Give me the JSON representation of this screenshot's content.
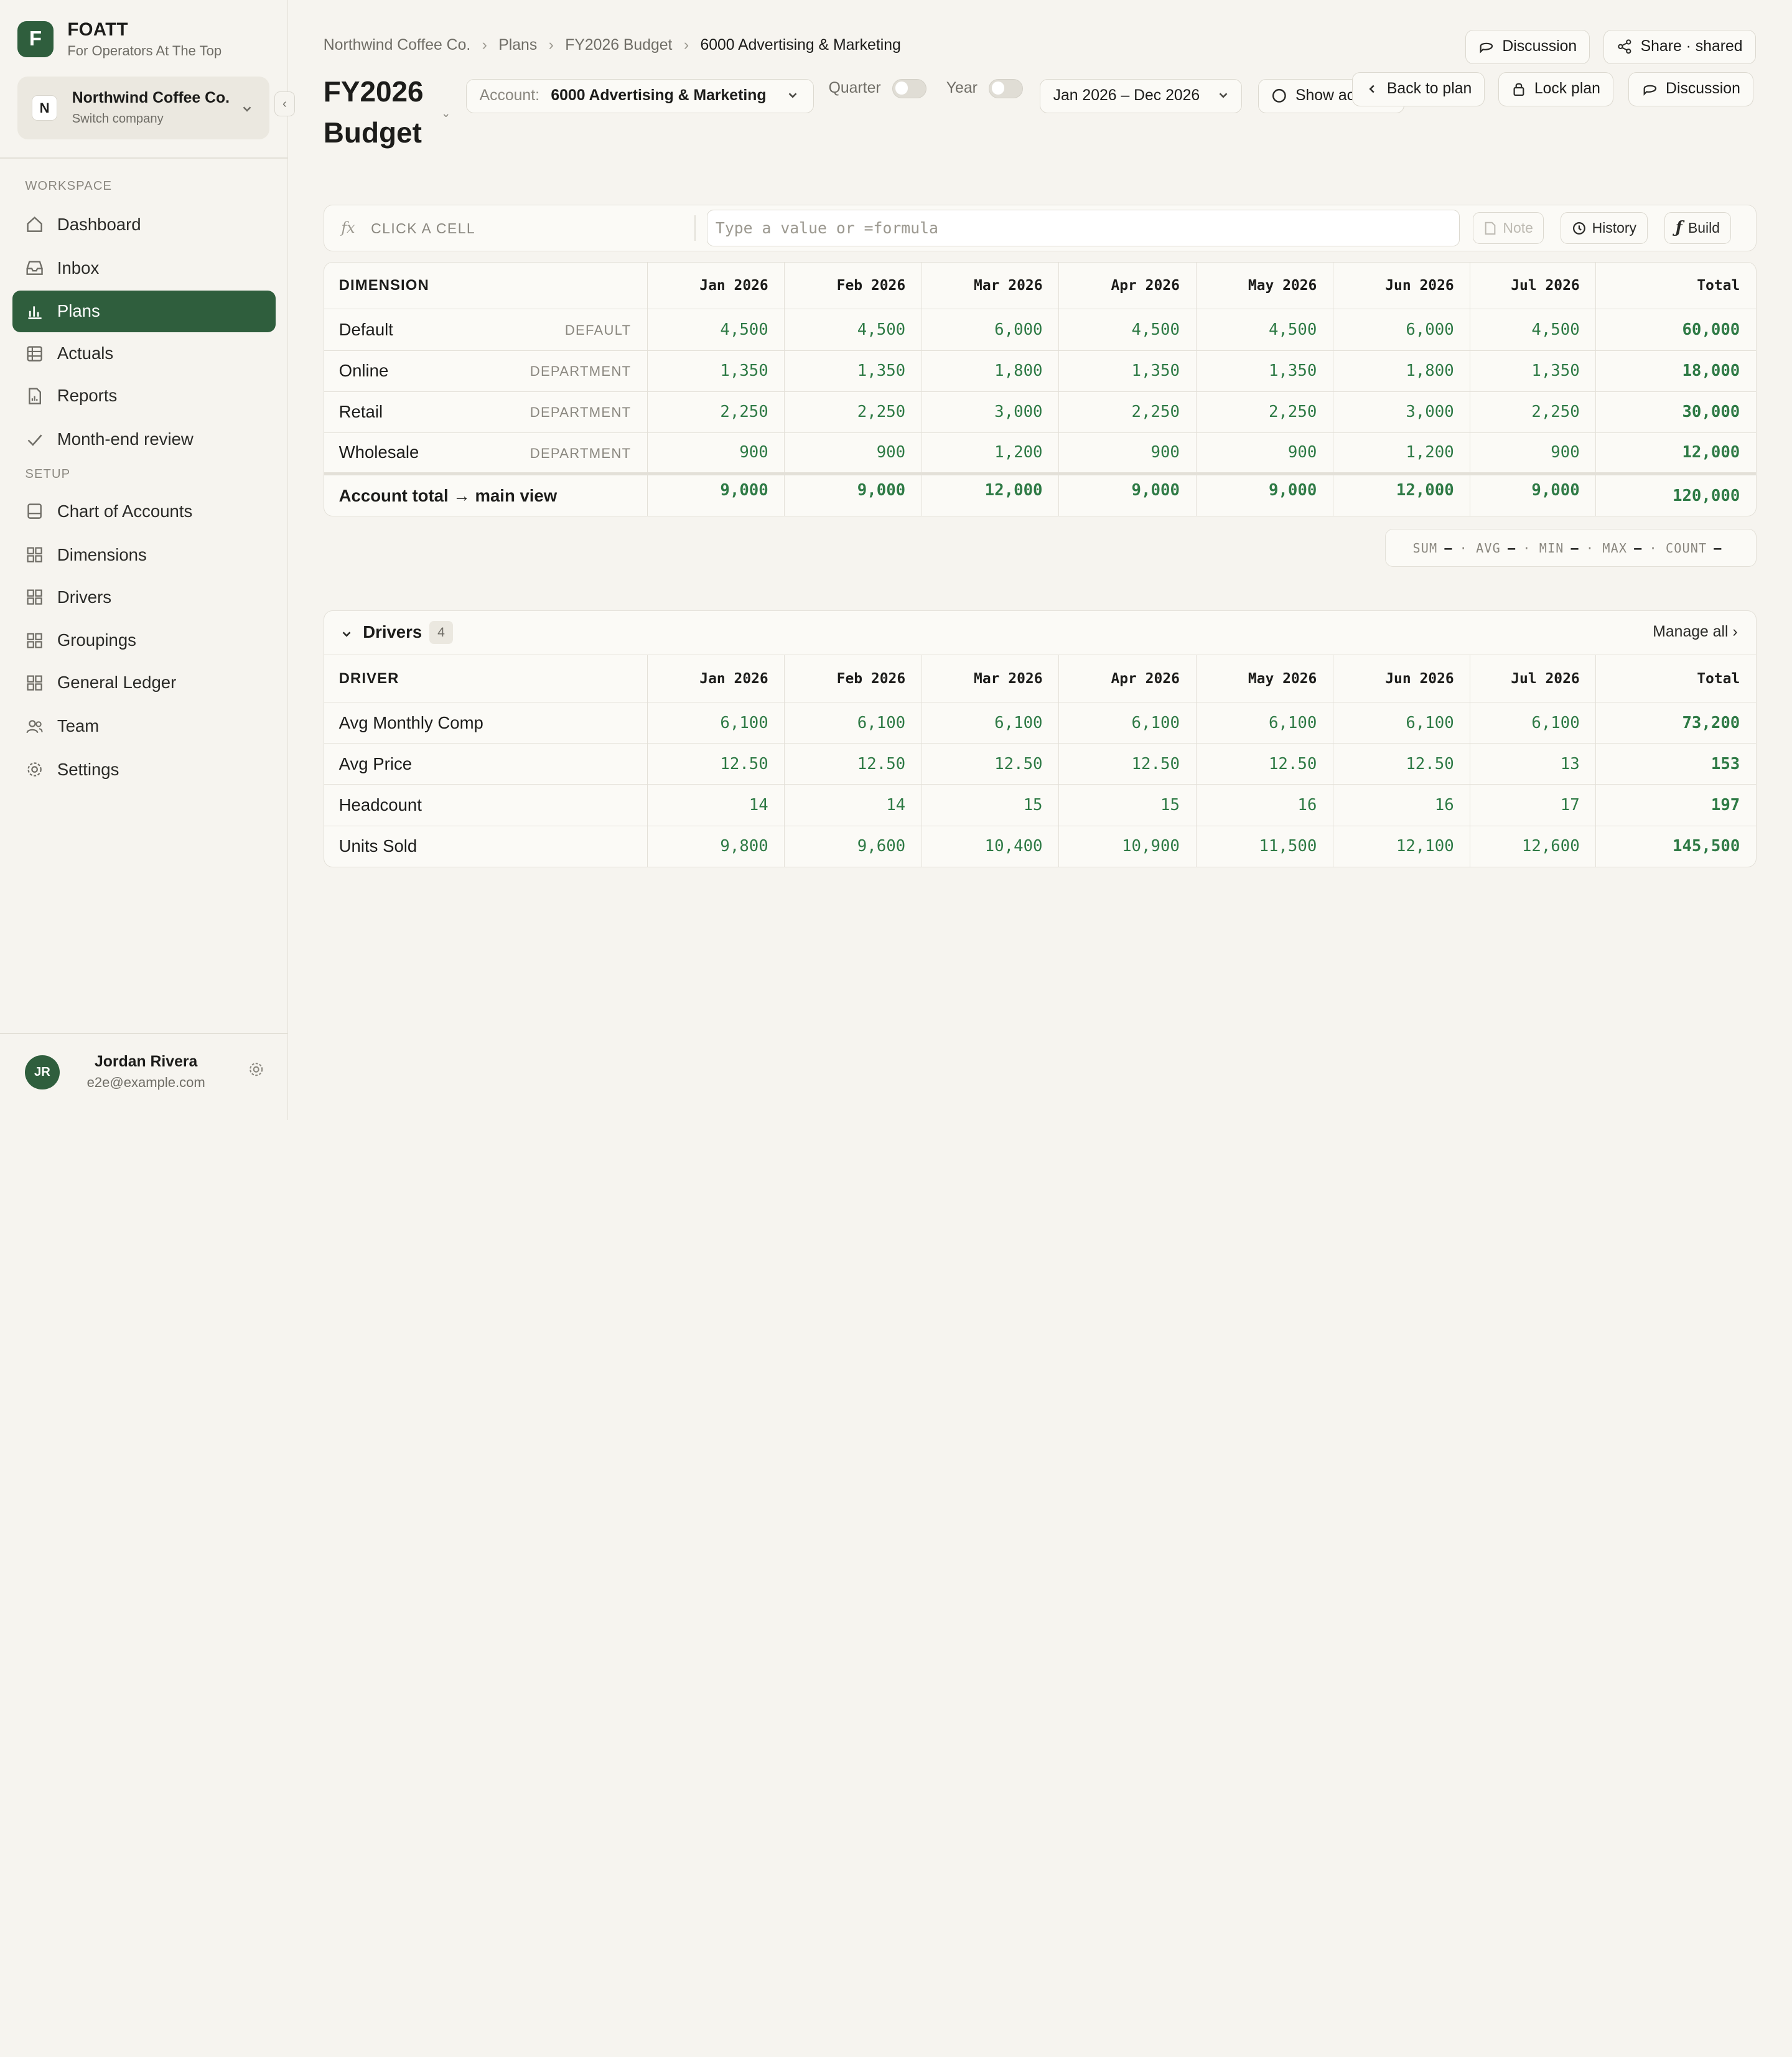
{
  "brand": {
    "name": "FOATT",
    "tagline": "For Operators At The Top",
    "logo_letter": "F"
  },
  "company": {
    "badge": "N",
    "name": "Northwind Coffee Co.",
    "sub": "Switch company"
  },
  "sidebar": {
    "workspace_label": "WORKSPACE",
    "setup_label": "SETUP",
    "workspace_items": [
      {
        "label": "Dashboard",
        "icon": "home-icon"
      },
      {
        "label": "Inbox",
        "icon": "inbox-icon"
      },
      {
        "label": "Plans",
        "icon": "bar-chart-icon",
        "active": true
      },
      {
        "label": "Actuals",
        "icon": "table-icon"
      },
      {
        "label": "Reports",
        "icon": "file-chart-icon"
      },
      {
        "label": "Month-end review",
        "icon": "check-icon"
      }
    ],
    "setup_items": [
      {
        "label": "Chart of Accounts",
        "icon": "ledger-icon"
      },
      {
        "label": "Dimensions",
        "icon": "grid-icon"
      },
      {
        "label": "Drivers",
        "icon": "grid-icon"
      },
      {
        "label": "Groupings",
        "icon": "grid-icon"
      },
      {
        "label": "General Ledger",
        "icon": "grid-icon"
      },
      {
        "label": "Team",
        "icon": "users-icon"
      },
      {
        "label": "Settings",
        "icon": "gear-icon"
      }
    ]
  },
  "user": {
    "initials": "JR",
    "name": "Jordan Rivera",
    "email": "e2e@example.com"
  },
  "breadcrumb": [
    "Northwind Coffee Co.",
    "Plans",
    "FY2026 Budget",
    "6000 Advertising & Marketing"
  ],
  "header": {
    "discussion_top": "Discussion",
    "share": "Share · shared",
    "title": "FY2026 Budget",
    "account_label": "Account:",
    "account_value": "6000 Advertising & Marketing",
    "quarter_label": "Quarter",
    "year_label": "Year",
    "date_range": "Jan 2026 – Dec 2026",
    "show_actuals": "Show ac",
    "back_to_plan": "Back to plan",
    "lock_plan": "Lock plan",
    "discussion": "Discussion"
  },
  "formula_bar": {
    "fx": "fx",
    "cell_ref": "CLICK A CELL",
    "placeholder": "Type a value or =formula",
    "note": "Note",
    "history": "History",
    "build": "Build"
  },
  "dimension_table": {
    "header": "DIMENSION",
    "columns": [
      "Jan 2026",
      "Feb 2026",
      "Mar 2026",
      "Apr 2026",
      "May 2026",
      "Jun 2026",
      "Jul 2026",
      "Total"
    ],
    "rows": [
      {
        "name": "Default",
        "tag": "DEFAULT",
        "values": [
          "4,500",
          "4,500",
          "6,000",
          "4,500",
          "4,500",
          "6,000",
          "4,500",
          "60,000"
        ]
      },
      {
        "name": "Online",
        "tag": "DEPARTMENT",
        "values": [
          "1,350",
          "1,350",
          "1,800",
          "1,350",
          "1,350",
          "1,800",
          "1,350",
          "18,000"
        ]
      },
      {
        "name": "Retail",
        "tag": "DEPARTMENT",
        "values": [
          "2,250",
          "2,250",
          "3,000",
          "2,250",
          "2,250",
          "3,000",
          "2,250",
          "30,000"
        ]
      },
      {
        "name": "Wholesale",
        "tag": "DEPARTMENT",
        "values": [
          "900",
          "900",
          "1,200",
          "900",
          "900",
          "1,200",
          "900",
          "12,000"
        ]
      }
    ],
    "total_row": {
      "name": "Account total → main view",
      "values": [
        "9,000",
        "9,000",
        "12,000",
        "9,000",
        "9,000",
        "12,000",
        "9,000",
        "120,000"
      ]
    }
  },
  "stats": {
    "sum": "SUM",
    "avg": "AVG",
    "min": "MIN",
    "max": "MAX",
    "count": "COUNT",
    "dash": "—",
    "dot": "·"
  },
  "drivers": {
    "title": "Drivers",
    "count": "4",
    "manage_all": "Manage all",
    "header": "DRIVER",
    "columns": [
      "Jan 2026",
      "Feb 2026",
      "Mar 2026",
      "Apr 2026",
      "May 2026",
      "Jun 2026",
      "Jul 2026",
      "Total"
    ],
    "rows": [
      {
        "name": "Avg Monthly Comp",
        "values": [
          "6,100",
          "6,100",
          "6,100",
          "6,100",
          "6,100",
          "6,100",
          "6,100",
          "73,200"
        ]
      },
      {
        "name": "Avg Price",
        "values": [
          "12.50",
          "12.50",
          "12.50",
          "12.50",
          "12.50",
          "12.50",
          "13",
          "153"
        ]
      },
      {
        "name": "Headcount",
        "values": [
          "14",
          "14",
          "15",
          "15",
          "16",
          "16",
          "17",
          "197"
        ]
      },
      {
        "name": "Units Sold",
        "values": [
          "9,800",
          "9,600",
          "10,400",
          "10,900",
          "11,500",
          "12,100",
          "12,600",
          "145,500"
        ]
      }
    ]
  },
  "colors": {
    "accent": "#2f5e3d",
    "value_green": "#2e7a45",
    "background": "#f6f4ef"
  }
}
